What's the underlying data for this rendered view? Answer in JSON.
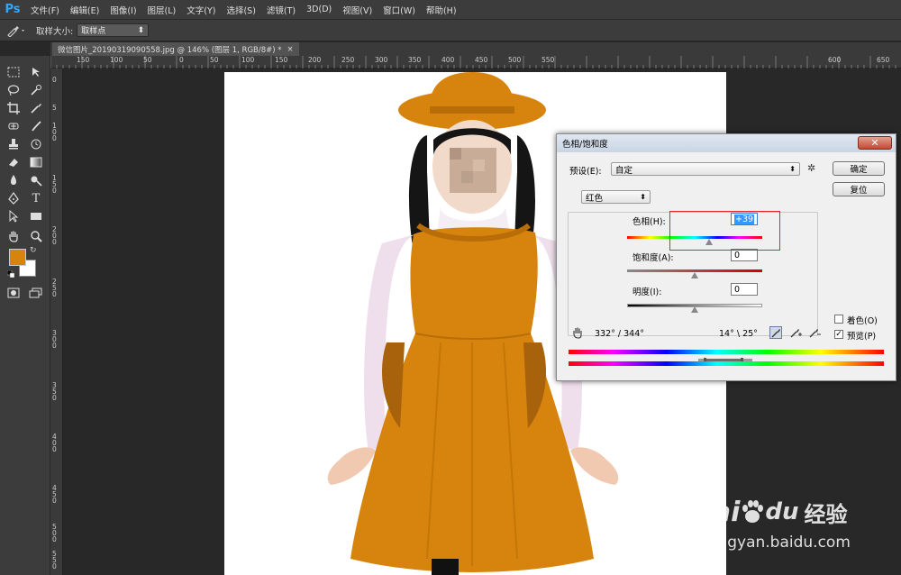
{
  "menubar": {
    "logo": "Ps",
    "items": [
      "文件(F)",
      "编辑(E)",
      "图像(I)",
      "图层(L)",
      "文字(Y)",
      "选择(S)",
      "滤镜(T)",
      "3D(D)",
      "视图(V)",
      "窗口(W)",
      "帮助(H)"
    ]
  },
  "options": {
    "sample_size_label": "取样大小:",
    "sample_size_value": "取样点"
  },
  "document": {
    "tab_title": "微信图片_20190319090558.jpg @ 146% (图层 1, RGB/8#) *",
    "close": "×"
  },
  "rulers": {
    "top": [
      "150",
      "100",
      "50",
      "0",
      "50",
      "100",
      "150",
      "200",
      "250",
      "300",
      "350",
      "400",
      "450",
      "500",
      "550",
      "600",
      "650"
    ],
    "left": [
      "0",
      "5",
      "1 0 0",
      "1 5 0",
      "2 0 0",
      "2 5 0",
      "3 0 0",
      "3 5 0",
      "4 0 0",
      "4 5 0",
      "5 0 0",
      "5 5 0"
    ]
  },
  "colors": {
    "foreground": "#d6840e",
    "background": "#ffffff",
    "dress": "#d6840e",
    "highlight_box": "#e0262f"
  },
  "dialog": {
    "title": "色相/饱和度",
    "close": "✕",
    "preset_label": "预设(E):",
    "preset_value": "自定",
    "ok": "确定",
    "reset": "复位",
    "channel": "红色",
    "hue_label": "色相(H):",
    "hue_value": "+39",
    "hue_level": 39,
    "saturation_label": "饱和度(A):",
    "saturation_value": "0",
    "lightness_label": "明度(I):",
    "lightness_value": "0",
    "range_left": "332° / 344°",
    "range_right": "14° \\ 25°",
    "colorize_label": "着色(O)",
    "colorize_checked": false,
    "preview_label": "预览(P)",
    "preview_checked": true
  },
  "watermark": {
    "brand": "Bai",
    "brand2": "du",
    "cn": "经验",
    "url": "jingyan.baidu.com"
  }
}
